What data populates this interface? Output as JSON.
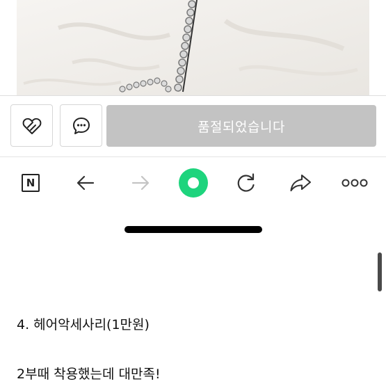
{
  "action_bar": {
    "like_icon": "heart-icon",
    "chat_icon": "chat-bubble-icon",
    "soldout_label": "품절되었습니다",
    "soldout_color": "#c3c3c3"
  },
  "browser_toolbar": {
    "naver_label": "N",
    "icons": [
      "naver-icon",
      "back-arrow-icon",
      "forward-arrow-icon",
      "green-dot-icon",
      "refresh-icon",
      "share-icon",
      "more-icon"
    ],
    "accent_color": "#1ed47d"
  },
  "content": {
    "line1": "4. 헤어악세사리(1만원)",
    "line2": "2부때 착용했는데 대만족!"
  }
}
